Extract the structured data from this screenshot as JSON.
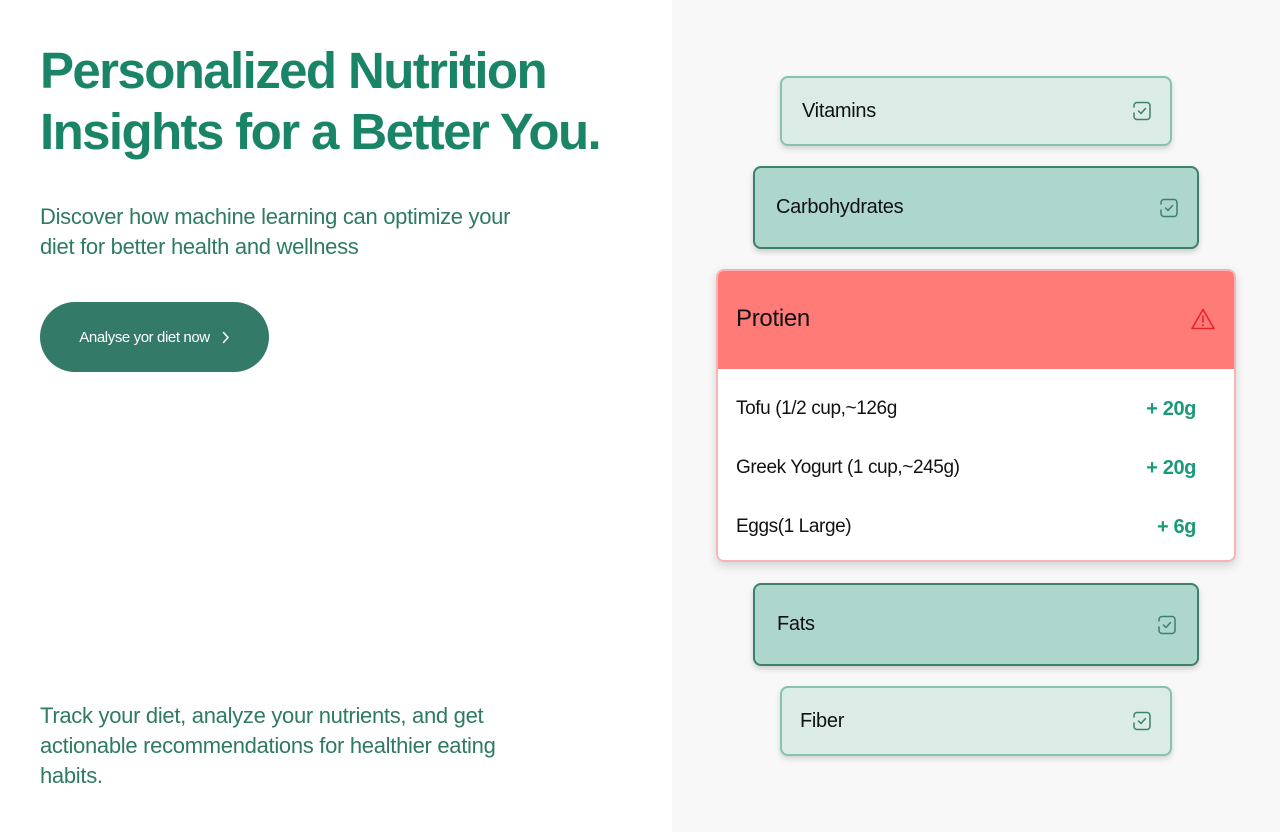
{
  "hero": {
    "headline_line1": "Personalized Nutrition",
    "headline_line2": "Insights for a Better You.",
    "subtitle": "Discover how machine learning can optimize your diet for better health and wellness",
    "cta_label": "Analyse yor diet now",
    "footer": "Track your diet, analyze your nutrients, and get actionable recommendations for healthier eating habits."
  },
  "nutrients": {
    "vitamins": {
      "label": "Vitamins",
      "status_icon": "check-icon"
    },
    "carbohydrates": {
      "label": "Carbohydrates",
      "status_icon": "check-icon"
    },
    "protein": {
      "label": "Protien",
      "status_icon": "warning-icon",
      "foods": [
        {
          "name": "Tofu (1/2 cup,~126g",
          "value": "+ 20g"
        },
        {
          "name": "Greek Yogurt (1 cup,~245g)",
          "value": "+ 20g"
        },
        {
          "name": "Eggs(1 Large)",
          "value": "+ 6g"
        }
      ]
    },
    "fats": {
      "label": "Fats",
      "status_icon": "check-icon"
    },
    "fiber": {
      "label": "Fiber",
      "status_icon": "check-icon"
    }
  },
  "colors": {
    "brand_green": "#1a8467",
    "button_green": "#347a68",
    "card_light": "#dbece7",
    "card_mid": "#add7cd",
    "alert_red": "#ff7b78",
    "value_green": "#1a9a78"
  }
}
